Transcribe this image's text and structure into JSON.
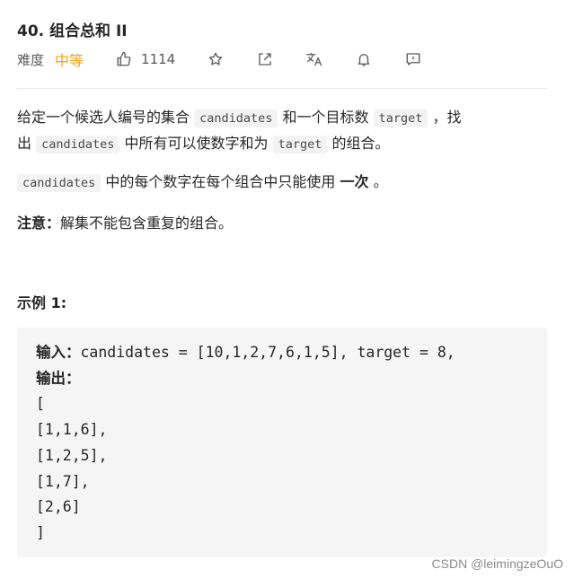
{
  "problem": {
    "title": "40. 组合总和 II",
    "difficulty_label": "难度",
    "difficulty": "中等",
    "difficulty_color": "#ffa116",
    "likes": "1114"
  },
  "toolbar": {
    "icons": [
      "thumbs-up-icon",
      "star-icon",
      "share-icon",
      "translate-icon",
      "bell-icon",
      "feedback-icon"
    ]
  },
  "description": {
    "p1_a": "给定一个候选人编号的集合",
    "p1_code1": "candidates",
    "p1_b": "和一个目标数",
    "p1_code2": "target",
    "p1_c": "，找",
    "p1_d": "出",
    "p1_code3": "candidates",
    "p1_e": "中所有可以使数字和为",
    "p1_code4": "target",
    "p1_f": "的组合。",
    "p2_code": "candidates",
    "p2_a": "中的每个数字在每个组合中只能使用",
    "p2_bold": "一次",
    "p2_b": "。",
    "note_label": "注意：",
    "note_text": "解集不能包含重复的组合。"
  },
  "example": {
    "title": "示例 1:",
    "input_label": "输入：",
    "input_value": "candidates = [10,1,2,7,6,1,5], target = 8,",
    "output_label": "输出：",
    "output_lines": [
      "[",
      "[1,1,6],",
      "[1,2,5],",
      "[1,7],",
      "[2,6]",
      "]"
    ]
  },
  "watermark": "CSDN @leimingzeOuO"
}
